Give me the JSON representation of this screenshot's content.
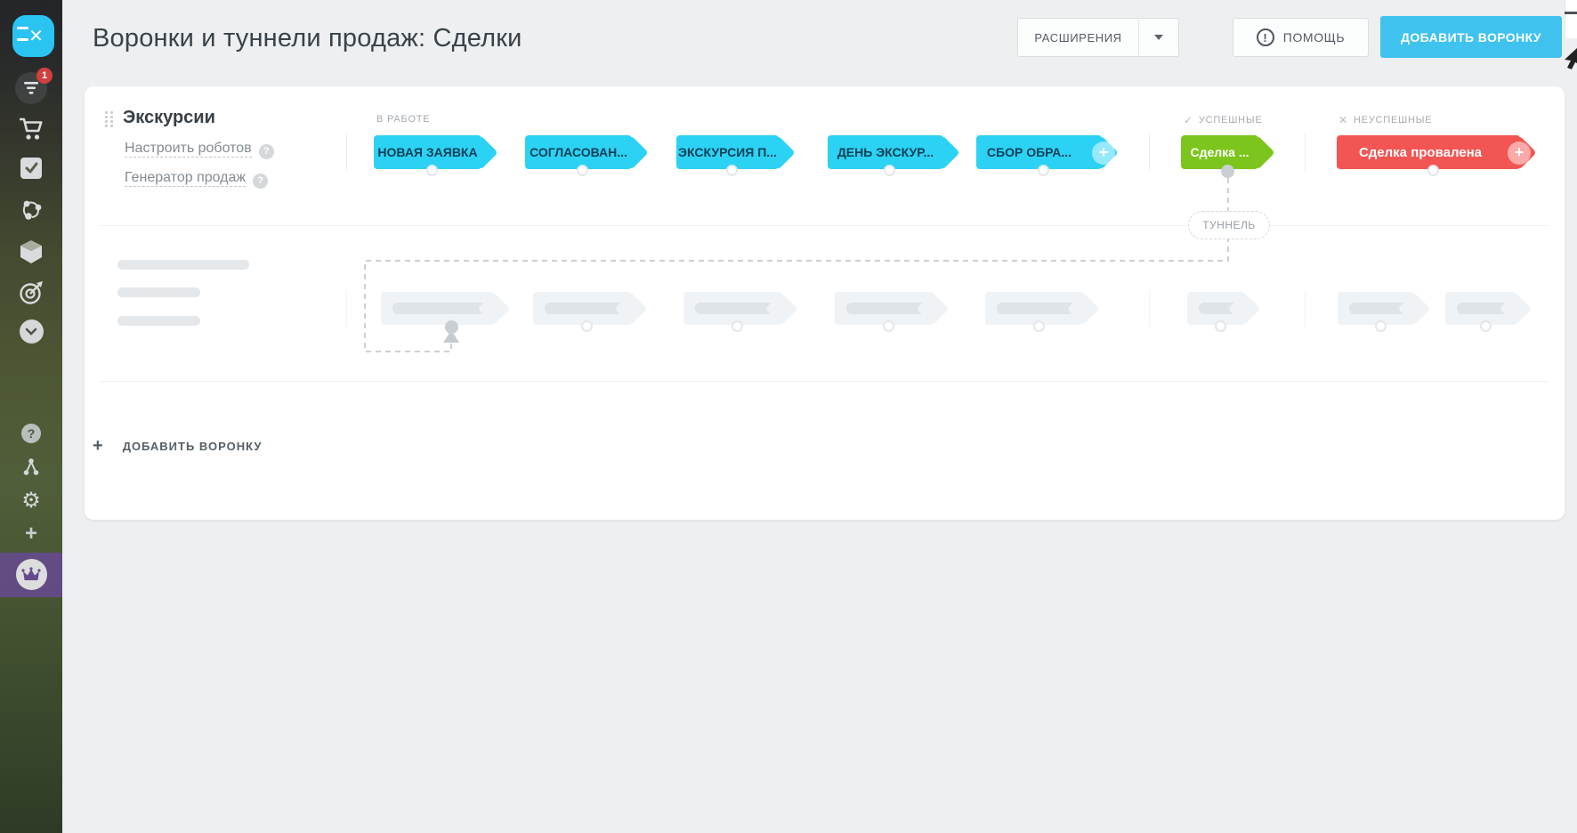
{
  "icons": {
    "close": "✕",
    "check": "✓",
    "cross": "✕",
    "plus": "+",
    "question": "?",
    "exclamation": "!",
    "gear": "⚙"
  },
  "header": {
    "title": "Воронки и туннели продаж: Сделки",
    "extensions_button": "РАСШИРЕНИЯ",
    "help_button": "ПОМОЩЬ",
    "add_funnel_button": "ДОБАВИТЬ ВОРОНКУ"
  },
  "sidebar": {
    "notification_count": "1",
    "icon_names": [
      "menu-close",
      "sales-funnel",
      "cart",
      "tasks",
      "network",
      "products",
      "target",
      "expand-more",
      "help",
      "profile",
      "settings",
      "add",
      "upgrade-crown"
    ]
  },
  "funnel": {
    "name": "Экскурсии",
    "robots_link": "Настроить роботов",
    "generator_link": "Генератор продаж",
    "column_in_progress": "В РАБОТЕ",
    "column_success": "УСПЕШНЫЕ",
    "column_fail": "НЕУСПЕШНЫЕ",
    "stages": [
      "НОВАЯ ЗАЯВКА",
      "СОГЛАСОВАН...",
      "ЭКСКУРСИЯ П...",
      "ДЕНЬ ЭКСКУР...",
      "СБОР ОБРА..."
    ],
    "success_stage": "Сделка ...",
    "fail_stage": "Сделка провалена",
    "tunnel_badge": "ТУННЕЛЬ"
  },
  "footer": {
    "add_funnel": "ДОБАВИТЬ ВОРОНКУ"
  },
  "colors": {
    "stage_cyan": "#2bd2f4",
    "button_blue": "#3fc3ee",
    "success_green": "#7cc51c",
    "fail_red": "#f25552",
    "badge_red": "#d23f3f",
    "sidebar_purple": "#664a8e"
  }
}
